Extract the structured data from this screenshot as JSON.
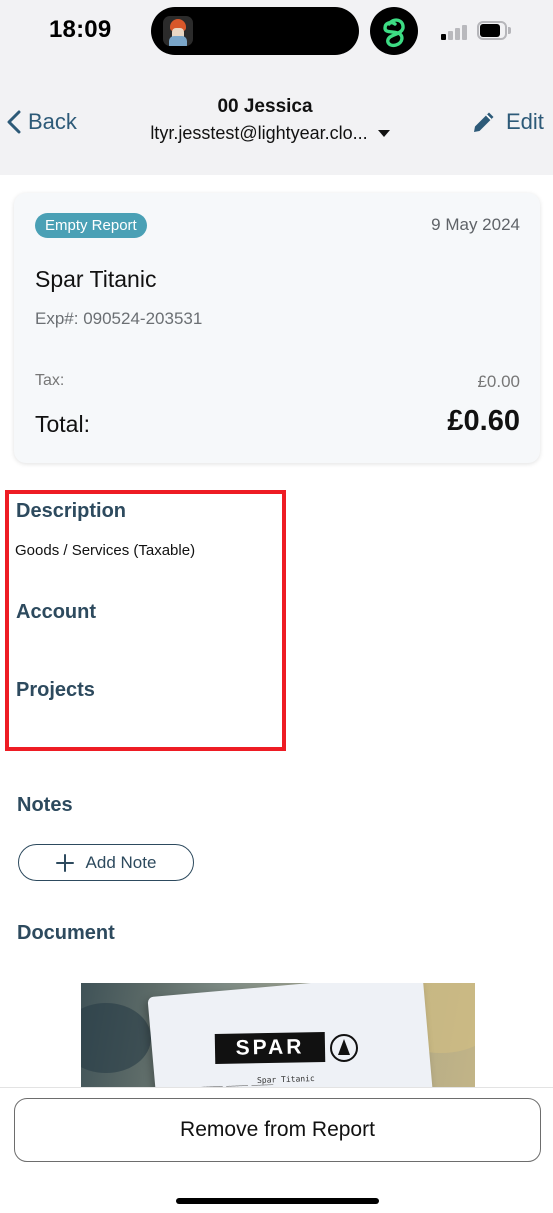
{
  "status_bar": {
    "time": "18:09",
    "icons": [
      "user-avatar-icon",
      "threads-app-icon",
      "cellular-signal-icon",
      "battery-icon"
    ]
  },
  "nav": {
    "back_label": "Back",
    "title": "00 Jessica",
    "subtitle": "ltyr.jesstest@lightyear.clo...",
    "edit_label": "Edit",
    "accent_color": "#2d5a78"
  },
  "summary_card": {
    "status": "Empty Report",
    "status_color": "#4aa0b5",
    "date": "9 May 2024",
    "merchant": "Spar Titanic",
    "expense_number": "Exp#: 090524-203531",
    "tax_label": "Tax:",
    "tax_value": "£0.00",
    "total_label": "Total:",
    "total_value": "£0.60"
  },
  "details": {
    "description_title": "Description",
    "description_value": "Goods / Services (Taxable)",
    "account_title": "Account",
    "projects_title": "Projects",
    "highlight_color": "#ee1c24"
  },
  "notes": {
    "title": "Notes",
    "add_note_label": "Add Note"
  },
  "document": {
    "title": "Document",
    "receipt_brand": "SPAR",
    "receipt_store": "Spar Titanic"
  },
  "footer": {
    "remove_label": "Remove from Report"
  }
}
